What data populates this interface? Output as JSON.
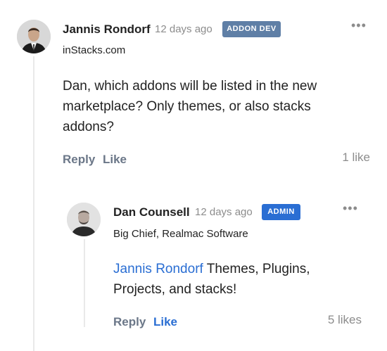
{
  "colors": {
    "addon_badge": "#5f7fa6",
    "admin_badge": "#2a6ed3",
    "link_blue": "#2a6ed3",
    "muted": "#8c8c8c",
    "action_gray": "#6b7788"
  },
  "post": {
    "author": "Jannis Rondorf",
    "time": "12 days ago",
    "badge": "ADDON DEV",
    "title": "inStacks.com",
    "body_line1": "Dan, which addons will be listed in the new",
    "body_line2": "marketplace? Only themes, or also stacks",
    "body_line3": "addons?",
    "reply_label": "Reply",
    "like_label": "Like",
    "likes_count": "1 like",
    "menu_icon": "more-horizontal-icon"
  },
  "reply": {
    "author": "Dan Counsell",
    "time": "12 days ago",
    "badge": "ADMIN",
    "title": "Big Chief, Realmac Software",
    "mention": "Jannis Rondorf",
    "body_line1_rest": " Themes, Plugins,",
    "body_line2": "Projects, and stacks!",
    "reply_label": "Reply",
    "like_label": "Like",
    "likes_count": "5 likes",
    "menu_icon": "more-horizontal-icon"
  }
}
